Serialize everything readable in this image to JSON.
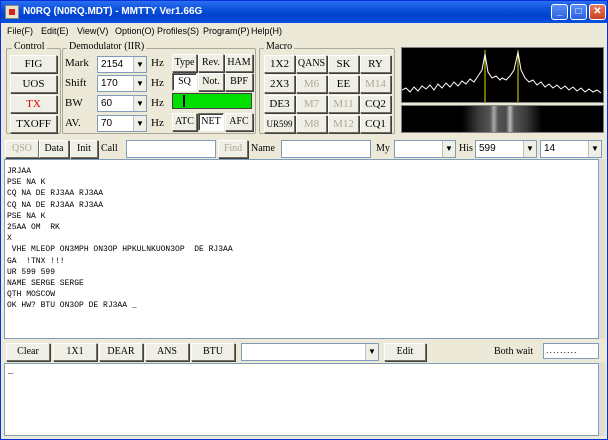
{
  "window": {
    "title": "N0RQ (N0RQ.MDT) - MMTTY Ver1.66G"
  },
  "menu": [
    "File(F)",
    "Edit(E)",
    "View(V)",
    "Option(O)",
    "Profiles(S)",
    "Program(P)",
    "Help(H)"
  ],
  "control": {
    "label": "Control",
    "fig": "FIG",
    "uos": "UOS",
    "tx": "TX",
    "txoff": "TXOFF"
  },
  "demod": {
    "label": "Demodulator (IIR)",
    "mark_label": "Mark",
    "mark_value": "2154",
    "mark_unit": "Hz",
    "shift_label": "Shift",
    "shift_value": "170",
    "shift_unit": "Hz",
    "bw_label": "BW",
    "bw_value": "60",
    "bw_unit": "Hz",
    "av_label": "AV.",
    "av_value": "70",
    "av_unit": "Hz",
    "type": "Type",
    "rev": "Rev.",
    "ham": "HAM",
    "sq": "SQ",
    "not": "Not.",
    "bpf": "BPF",
    "atc": "ATC",
    "net": "NET",
    "afc": "AFC",
    "level_color": "#00e000"
  },
  "macro": {
    "label": "Macro",
    "buttons": [
      [
        "1X2",
        "QANS",
        "SK",
        "RY"
      ],
      [
        "2X3",
        "M6",
        "EE",
        "M14"
      ],
      [
        "DE3",
        "M7",
        "M11",
        "CQ2"
      ],
      [
        "UR599",
        "M8",
        "M12",
        "CQ1"
      ]
    ]
  },
  "callbar": {
    "qso": "QSO",
    "data": "Data",
    "init": "Init",
    "call_label": "Call",
    "call_value": "",
    "find": "Find",
    "name_label": "Name",
    "name_value": "",
    "my_label": "My",
    "my_value": "",
    "his_label": "His",
    "his_value": "599",
    "num_value": "14"
  },
  "rx_lines": [
    "JRJAA",
    "PSE NA K",
    "CQ NA DE RJ3AA RJ3AA",
    "CQ NA DE RJ3AA RJ3AA",
    "PSE NA K",
    "25AA OM  RK",
    "X",
    " VHE MLEOP ON3MPH ON3OP HPKULNKUON3OP  DE RJ3AA",
    "GA  !TNX !!!",
    "UR 599 599",
    "NAME SERGE SERGE",
    "QTH MOSCOW",
    "OK HW? BTU ON3OP DE RJ3AA _"
  ],
  "toolbar": {
    "clear": "Clear",
    "b1x1": "1X1",
    "dear": "DEAR",
    "ans": "ANS",
    "btu": "BTU",
    "combo_value": "",
    "edit": "Edit",
    "both_wait": "Both wait"
  },
  "tx_text": "_"
}
